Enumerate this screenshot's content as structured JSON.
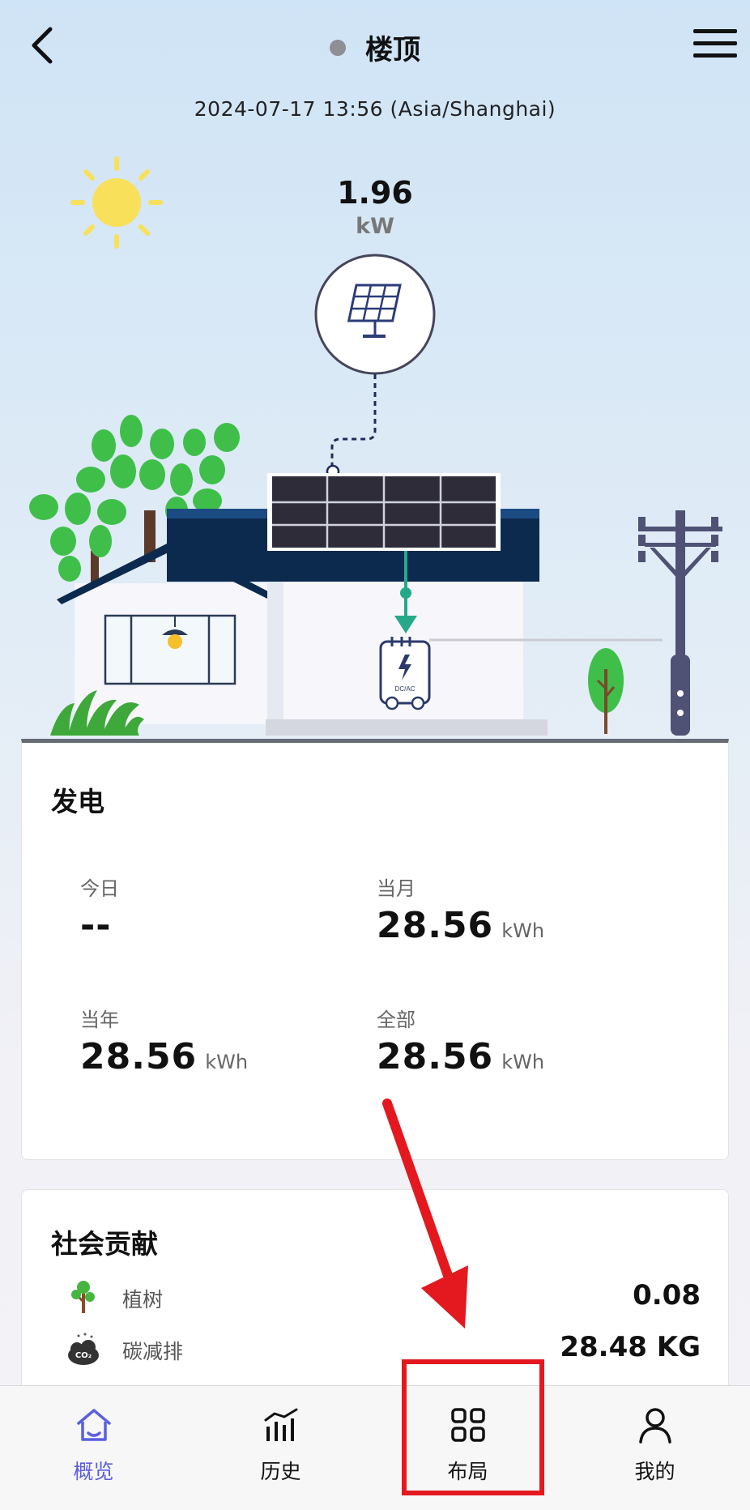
{
  "header": {
    "title": "楼顶",
    "datetime": "2024-07-17 13:56 (Asia/Shanghai)"
  },
  "pv": {
    "power_value": "1.96",
    "power_unit": "kW",
    "device_label": "DC/AC"
  },
  "generation": {
    "title": "发电",
    "stats": [
      {
        "label": "今日",
        "value": "--",
        "unit": ""
      },
      {
        "label": "当月",
        "value": "28.56",
        "unit": "kWh"
      },
      {
        "label": "当年",
        "value": "28.56",
        "unit": "kWh"
      },
      {
        "label": "全部",
        "value": "28.56",
        "unit": "kWh"
      }
    ]
  },
  "social": {
    "title": "社会贡献",
    "rows": [
      {
        "icon": "tree-icon",
        "label": "植树",
        "value": "0.08"
      },
      {
        "icon": "co2-icon",
        "label": "碳减排",
        "value": "28.48 KG"
      },
      {
        "icon_label": "CO₂"
      }
    ]
  },
  "tabbar": {
    "active_color": "#5b5fe0",
    "tabs": [
      {
        "label": "概览",
        "icon": "home-icon",
        "active": true
      },
      {
        "label": "历史",
        "icon": "bar-chart-icon",
        "active": false
      },
      {
        "label": "布局",
        "icon": "grid-icon",
        "active": false
      },
      {
        "label": "我的",
        "icon": "user-icon",
        "active": false
      }
    ]
  },
  "colors": {
    "annotation_red": "#e3191f",
    "leaf_green": "#3fbf4a",
    "roof_navy": "#0c2a4e",
    "flow_teal": "#26a98a"
  }
}
